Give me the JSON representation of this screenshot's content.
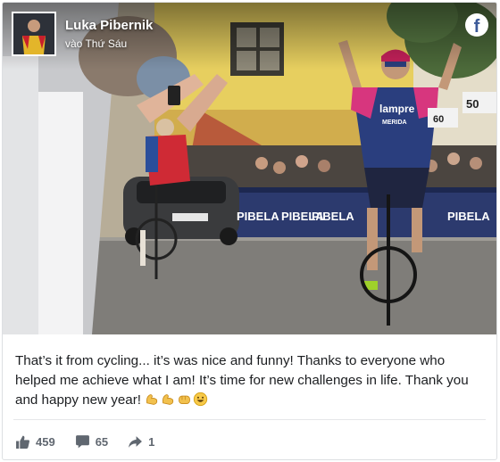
{
  "post": {
    "author": "Luka Pibernik",
    "time": "vào Thứ Sáu",
    "network_icon": "facebook-icon",
    "message": "That’s it from cycling... it’s was nice and funny! Thanks to everyone who helped me achieve what I am! It’s time for new challenges in life. Thank you and happy new year!",
    "emojis": [
      "flexed-biceps",
      "flexed-biceps",
      "oncoming-fist",
      "grinning-face"
    ]
  },
  "photo": {
    "jersey_brand": "lampre",
    "jersey_sponsor": "MERIDA",
    "distance_sign": "50",
    "distance_sign_2": "60",
    "banner_texts": [
      "PIBELA",
      "PIBELA",
      "PIBELA",
      "PIBELA"
    ]
  },
  "stats": {
    "likes": "459",
    "comments": "65",
    "shares": "1"
  },
  "colors": {
    "facebook_blue": "#3b5998",
    "stat_gray": "#606770",
    "jersey_blue": "#2a3e7e",
    "jersey_pink": "#d7367e"
  }
}
